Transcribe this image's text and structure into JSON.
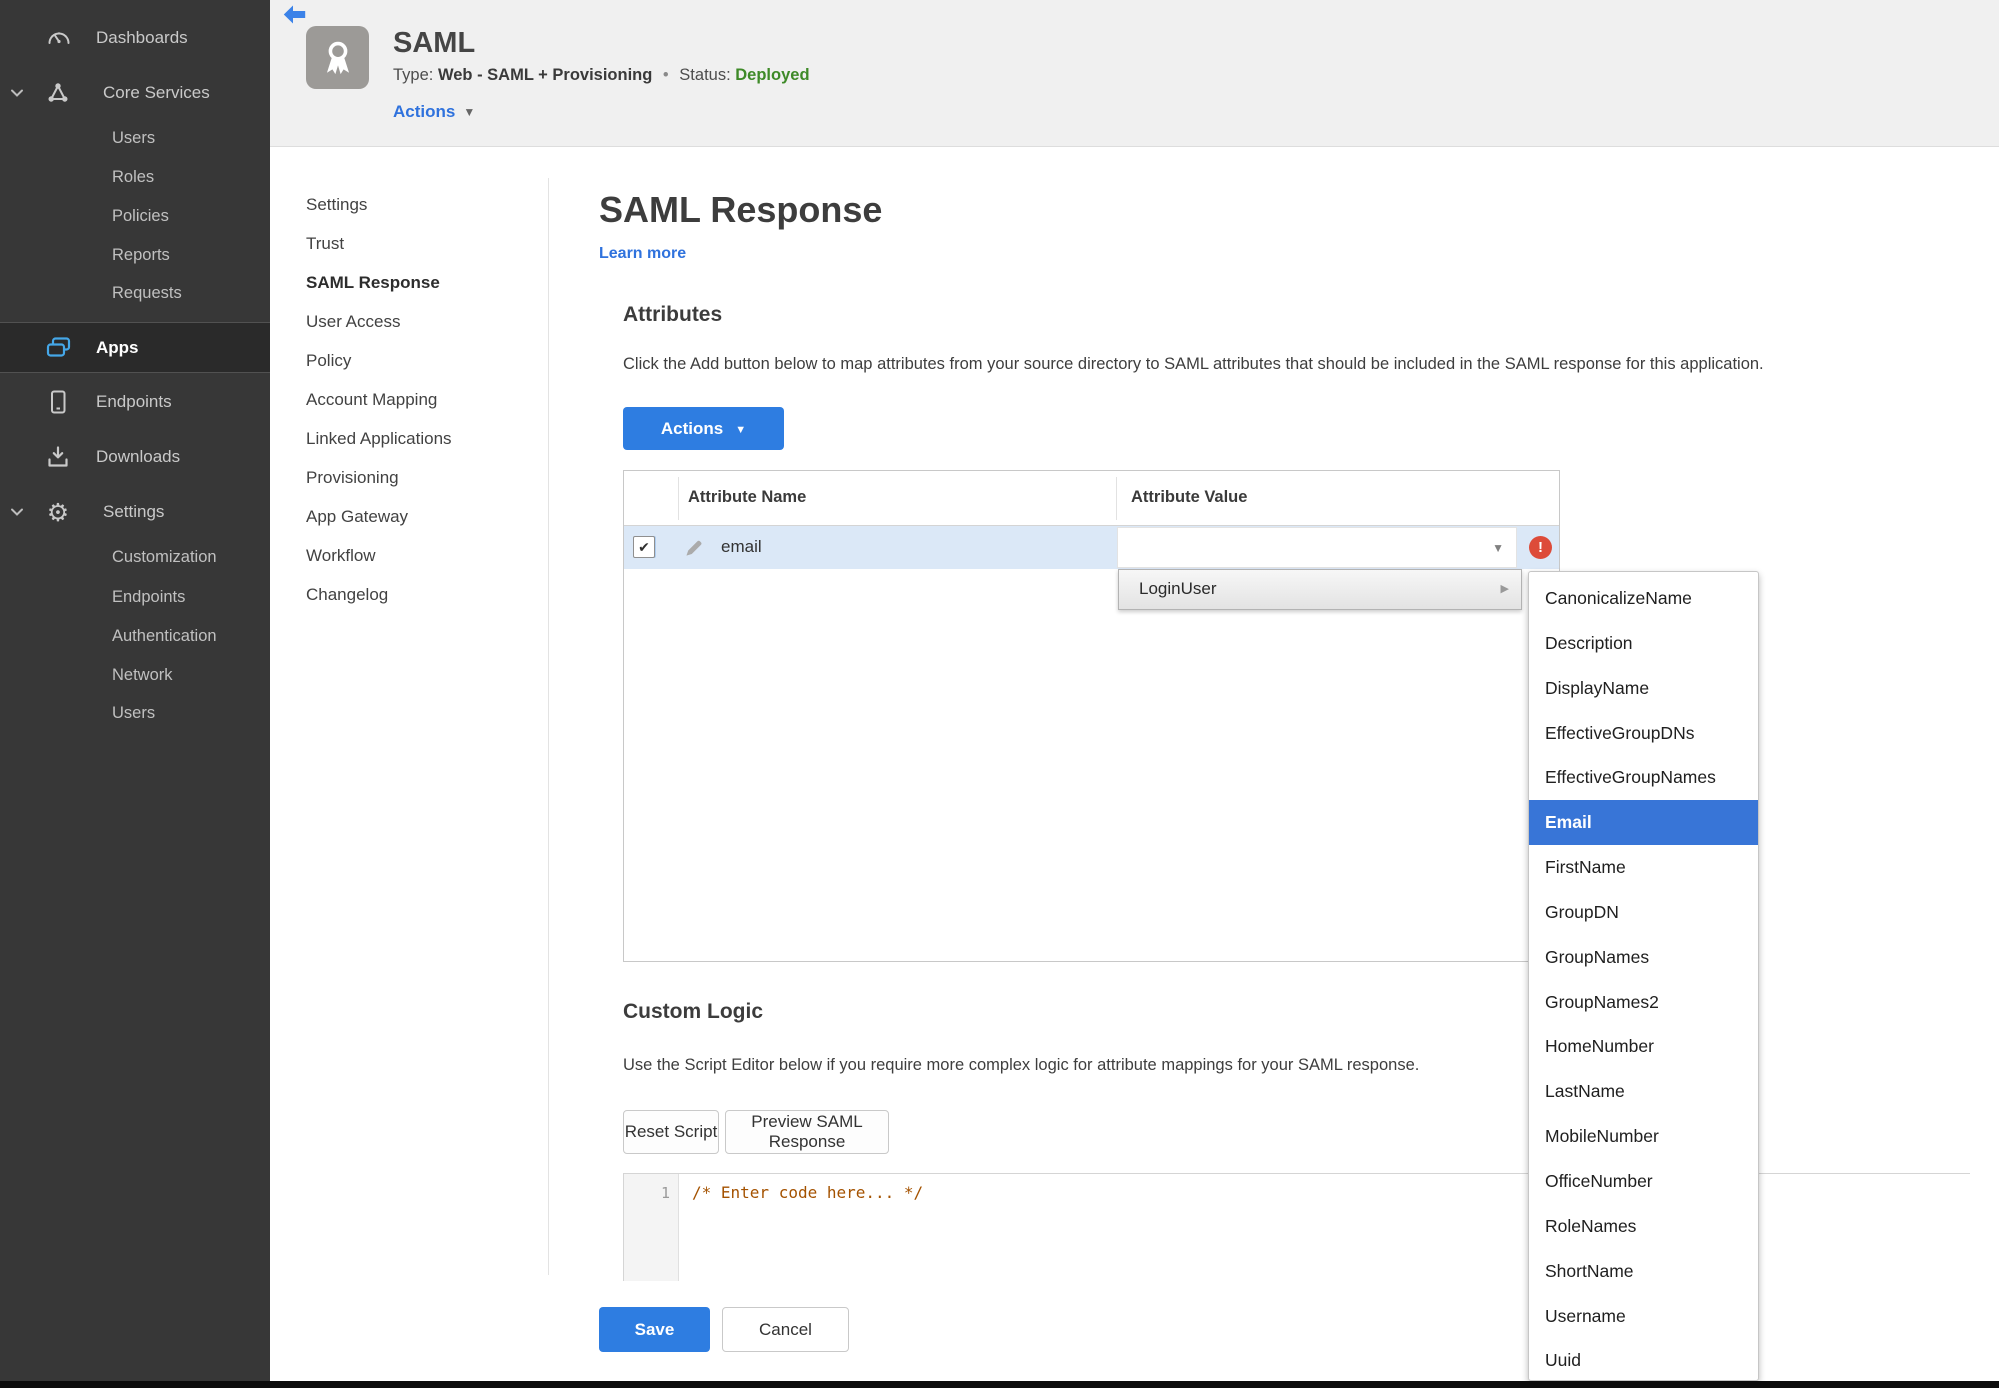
{
  "app_header": {
    "title": "SAML",
    "type_label": "Type:",
    "type_value": "Web - SAML + Provisioning",
    "separator": "•",
    "status_label": "Status:",
    "status_value": "Deployed",
    "actions_label": "Actions"
  },
  "sidebar": {
    "items": [
      {
        "label": "Dashboards"
      },
      {
        "label": "Core Services"
      },
      {
        "label": "Users"
      },
      {
        "label": "Roles"
      },
      {
        "label": "Policies"
      },
      {
        "label": "Reports"
      },
      {
        "label": "Requests"
      },
      {
        "label": "Apps"
      },
      {
        "label": "Endpoints"
      },
      {
        "label": "Downloads"
      },
      {
        "label": "Settings"
      },
      {
        "label": "Customization"
      },
      {
        "label": "Endpoints"
      },
      {
        "label": "Authentication"
      },
      {
        "label": "Network"
      },
      {
        "label": "Users"
      }
    ]
  },
  "subnav": {
    "items": [
      {
        "label": "Settings"
      },
      {
        "label": "Trust"
      },
      {
        "label": "SAML Response"
      },
      {
        "label": "User Access"
      },
      {
        "label": "Policy"
      },
      {
        "label": "Account Mapping"
      },
      {
        "label": "Linked Applications"
      },
      {
        "label": "Provisioning"
      },
      {
        "label": "App Gateway"
      },
      {
        "label": "Workflow"
      },
      {
        "label": "Changelog"
      }
    ],
    "active_item": "SAML Response"
  },
  "page": {
    "title": "SAML Response",
    "learn_more_link": "Learn more"
  },
  "attributes_section": {
    "heading": "Attributes",
    "description": "Click the Add button below to map attributes from your source directory to SAML attributes that should be included in the SAML response for this application.",
    "actions_button_label": "Actions",
    "table": {
      "columns": [
        "Attribute Name",
        "Attribute Value"
      ],
      "row": {
        "checked": true,
        "attribute_name": "email",
        "attribute_value": ""
      }
    }
  },
  "value_menu": {
    "root_item": "LoginUser",
    "options": [
      "CanonicalizeName",
      "Description",
      "DisplayName",
      "EffectiveGroupDNs",
      "EffectiveGroupNames",
      "Email",
      "FirstName",
      "GroupDN",
      "GroupNames",
      "GroupNames2",
      "HomeNumber",
      "LastName",
      "MobileNumber",
      "OfficeNumber",
      "RoleNames",
      "ShortName",
      "Username",
      "Uuid"
    ],
    "highlighted_option": "Email"
  },
  "custom_logic_section": {
    "heading": "Custom Logic",
    "description": "Use the Script Editor below if you require more complex logic for attribute mappings for your SAML response.",
    "reset_button_label": "Reset Script",
    "preview_button_label": "Preview SAML Response",
    "editor": {
      "line_number": "1",
      "code": "/* Enter code here... */"
    }
  },
  "footer_actions": {
    "save_label": "Save",
    "cancel_label": "Cancel"
  },
  "icons": {
    "check": "✔",
    "caret_down": "▼",
    "submenu_arrow": "▶",
    "error_mark": "!",
    "gear": "⚙"
  },
  "colors": {
    "accent_blue": "#2e7de1",
    "menu_highlight_blue": "#3875d7",
    "error_red": "#dd4b39",
    "status_green": "#3e8a28",
    "link_blue": "#2f72dd",
    "row_highlight": "#dbe8f7",
    "sidebar_bg": "#373737"
  }
}
